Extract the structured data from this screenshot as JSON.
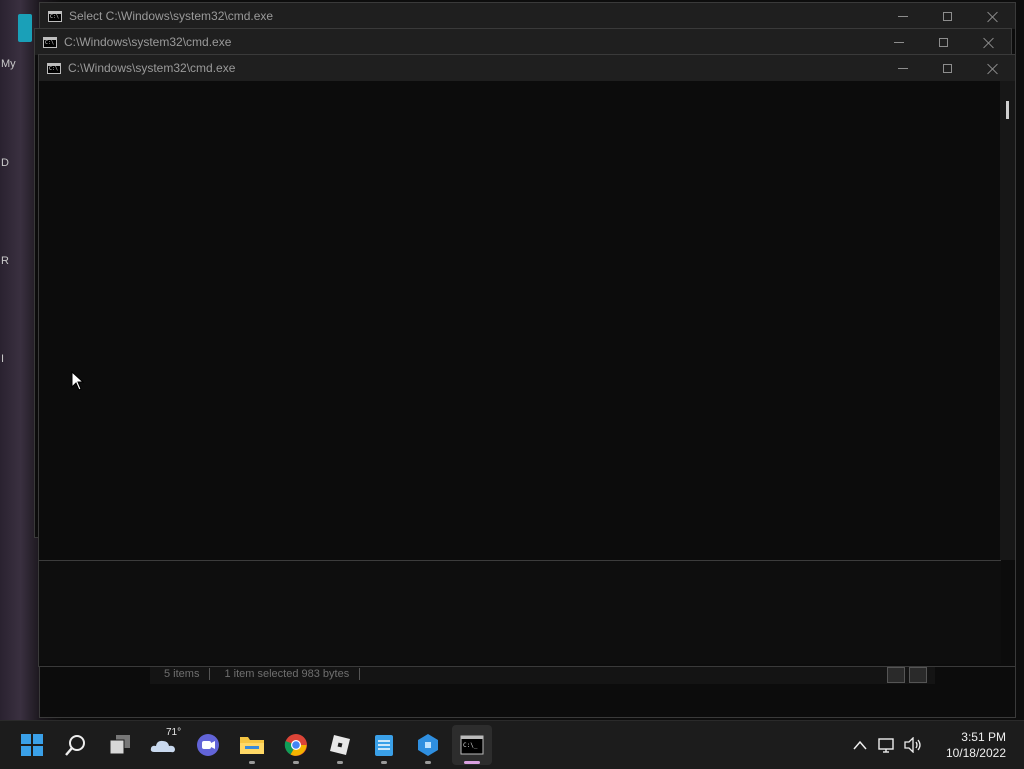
{
  "desktop": {
    "labels": [
      "My",
      "D",
      "R",
      "I"
    ]
  },
  "windows": [
    {
      "title": "Select C:\\Windows\\system32\\cmd.exe"
    },
    {
      "title": "C:\\Windows\\system32\\cmd.exe"
    },
    {
      "title": "C:\\Windows\\system32\\cmd.exe"
    }
  ],
  "explorer_status": {
    "items": "5 items",
    "selected": "1 item selected  983 bytes"
  },
  "taskbar": {
    "weather_temp": "71°",
    "apps": [
      "start-icon",
      "search-icon",
      "task-view-icon",
      "weather-icon",
      "teams-chat-icon",
      "file-explorer-icon",
      "chrome-icon",
      "roblox-icon",
      "notepad-icon",
      "roblox-studio-icon",
      "command-prompt-icon"
    ],
    "time": "3:51 PM",
    "date": "10/18/2022"
  },
  "colors": {
    "console_bg": "#0c0c0c",
    "titlebar_bg": "#1f1f1f",
    "taskbar_bg": "#1c1c1c",
    "start_blue": "#3aa0e8"
  }
}
